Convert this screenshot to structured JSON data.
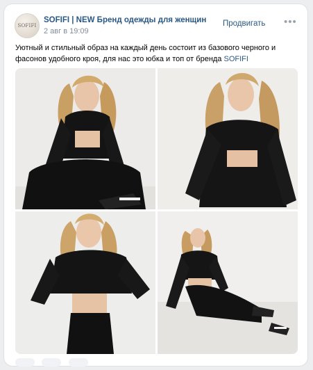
{
  "post": {
    "author": "SOFIFI | NEW Бренд одежды для женщин",
    "avatar_text": "SOFIFI",
    "date": "2 авг в 19:09",
    "promote_label": "Продвигать",
    "more_label": "•••",
    "text_main": "Уютный и стильный образ на каждый день состоит из базового черного и фасонов удобного кроя, для нас это юбка и топ от бренда ",
    "text_link": "SOFIFI"
  },
  "photos": [
    {
      "name": "photo-1",
      "desc": "sitting"
    },
    {
      "name": "photo-2",
      "desc": "laughing"
    },
    {
      "name": "photo-3",
      "desc": "standing"
    },
    {
      "name": "photo-4",
      "desc": "seated on floor"
    }
  ],
  "colors": {
    "link": "#2a5885",
    "muted": "#818c99",
    "background": "#edeef0",
    "card": "#ffffff"
  }
}
